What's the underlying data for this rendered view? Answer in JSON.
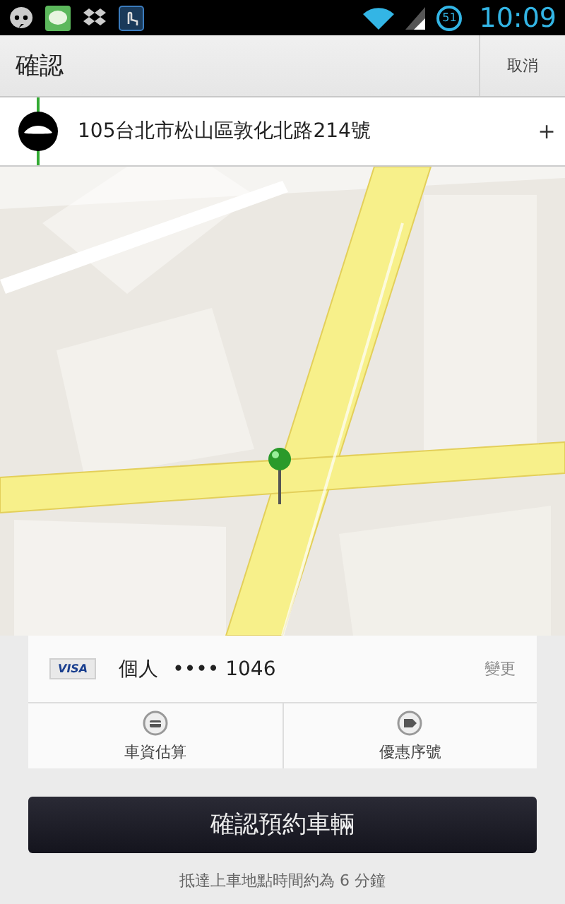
{
  "status_bar": {
    "battery": "51",
    "time": "10:09"
  },
  "header": {
    "title": "確認",
    "cancel": "取消"
  },
  "pickup": {
    "address": "105台北市松山區敦化北路214號",
    "add": "+"
  },
  "payment": {
    "card_brand": "VISA",
    "profile": "個人",
    "card_number": "•••• 1046",
    "change": "變更"
  },
  "actions": [
    {
      "kind": "fare",
      "label": "車資估算"
    },
    {
      "kind": "promo",
      "label": "優惠序號"
    }
  ],
  "confirm_button": "確認預約車輛",
  "eta_note": "抵達上車地點時間約為 6 分鐘"
}
